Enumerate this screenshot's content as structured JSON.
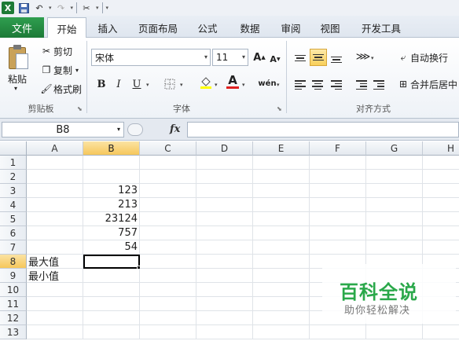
{
  "qat": {
    "icons": [
      "excel-logo",
      "save-icon",
      "undo-icon",
      "redo-icon",
      "tools-icon"
    ]
  },
  "tabs": [
    {
      "label": "文件"
    },
    {
      "label": "开始"
    },
    {
      "label": "插入"
    },
    {
      "label": "页面布局"
    },
    {
      "label": "公式"
    },
    {
      "label": "数据"
    },
    {
      "label": "审阅"
    },
    {
      "label": "视图"
    },
    {
      "label": "开发工具"
    }
  ],
  "clipboard": {
    "paste": "粘贴",
    "cut": "剪切",
    "copy": "复制",
    "format_painter": "格式刷",
    "group": "剪贴板"
  },
  "font": {
    "name": "宋体",
    "size": "11",
    "group": "字体",
    "bold": "B",
    "italic": "I",
    "underline": "U",
    "wen": "wén"
  },
  "alignment": {
    "wrap": "自动换行",
    "merge": "合并后居中",
    "group": "对齐方式"
  },
  "formula_bar": {
    "name_box": "B8",
    "fx": "fx",
    "formula": ""
  },
  "columns": [
    "A",
    "B",
    "C",
    "D",
    "E",
    "F",
    "G",
    "H"
  ],
  "rows": [
    "1",
    "2",
    "3",
    "4",
    "5",
    "6",
    "7",
    "8",
    "9",
    "10",
    "11",
    "12",
    "13"
  ],
  "cells": {
    "B3": "123",
    "B4": "213",
    "B5": "23124",
    "B6": "757",
    "B7": "54",
    "A8": "最大值",
    "A9": "最小值"
  },
  "selected": {
    "column": "B",
    "row": "8"
  },
  "watermark": {
    "title": "百科全说",
    "subtitle": "助你轻松解决"
  },
  "colors": {
    "excel_green": "#1d7a36",
    "selection": "#f6c75b"
  }
}
